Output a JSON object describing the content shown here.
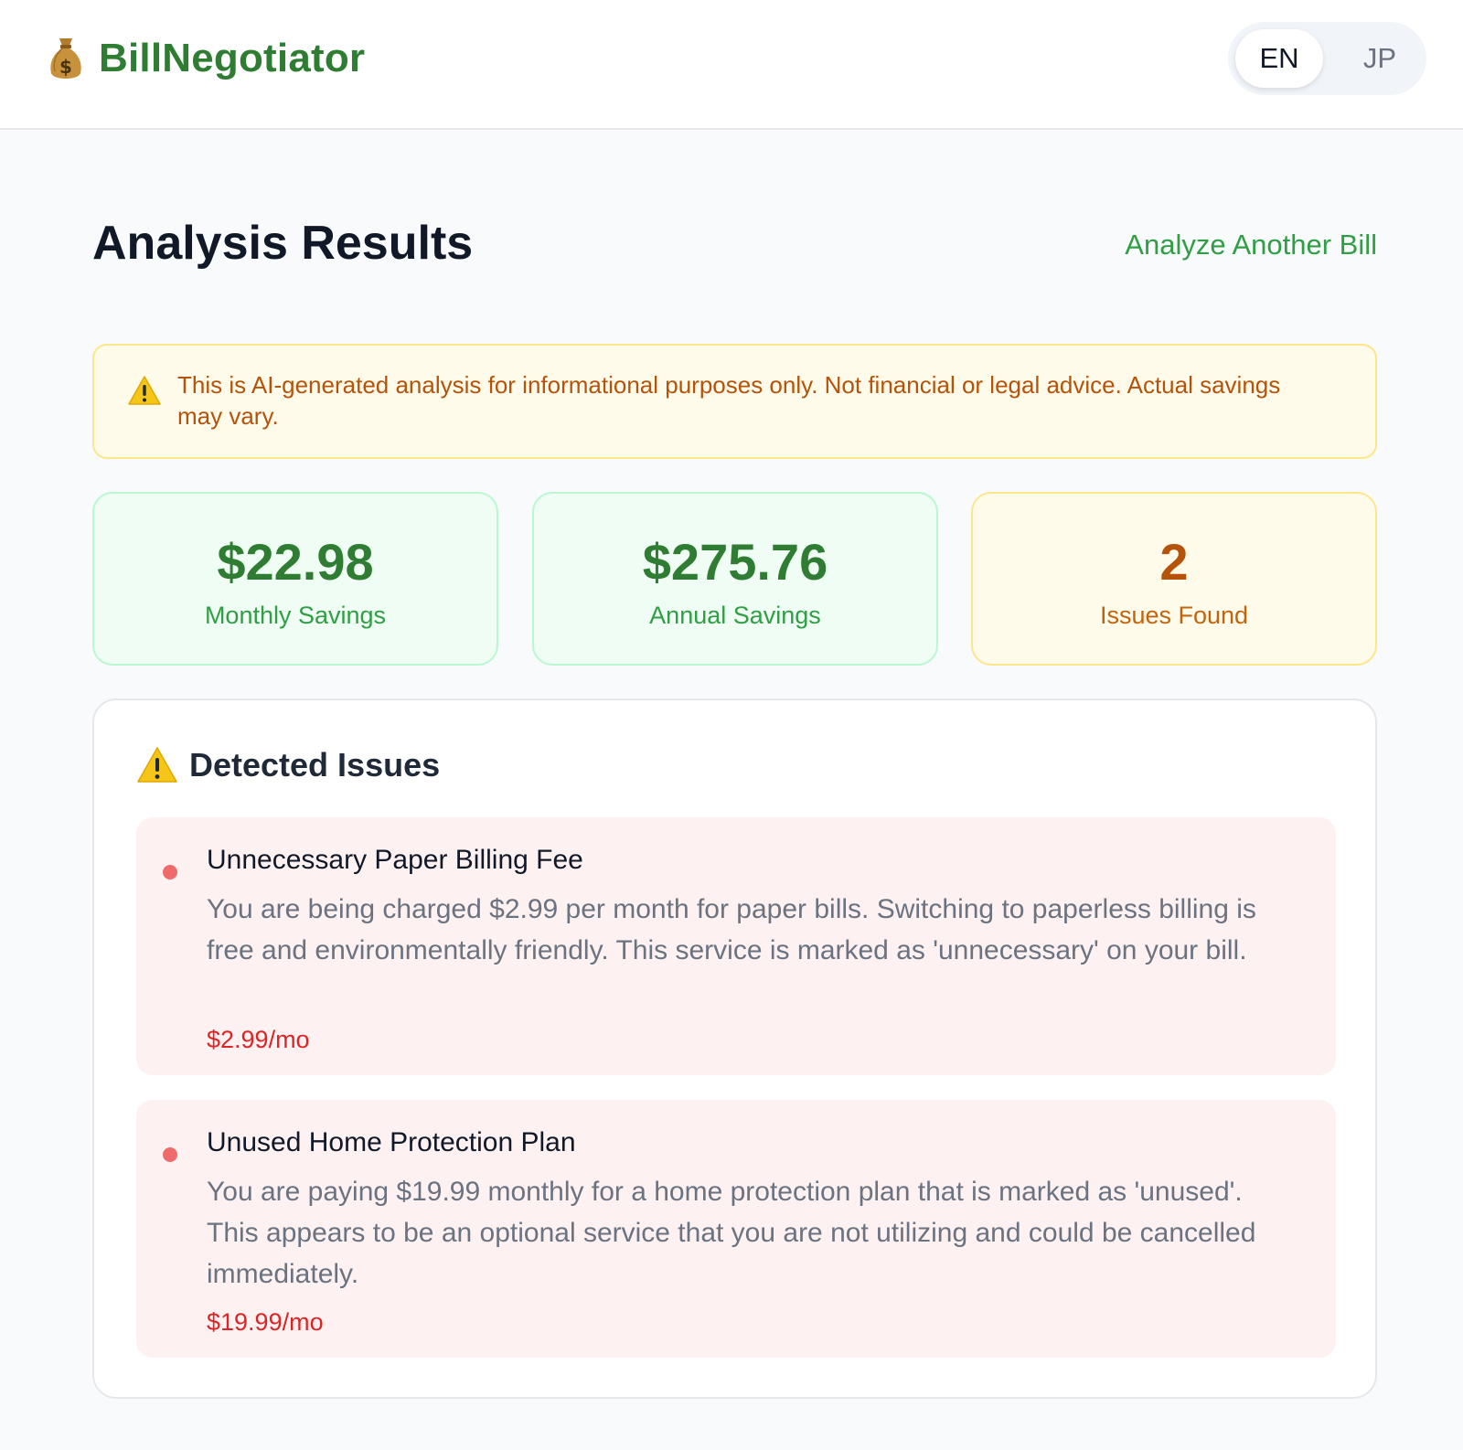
{
  "header": {
    "brand_icon": "money-bag-icon",
    "brand_name": "BillNegotiator",
    "languages": [
      {
        "label": "EN",
        "active": true
      },
      {
        "label": "JP",
        "active": false
      }
    ]
  },
  "page": {
    "title": "Analysis Results",
    "analyze_another_label": "Analyze Another Bill"
  },
  "disclaimer": {
    "icon": "warning-icon",
    "text": "This is AI-generated analysis for informational purposes only. Not financial or legal advice. Actual savings may vary."
  },
  "stats": [
    {
      "value": "$22.98",
      "label": "Monthly Savings"
    },
    {
      "value": "$275.76",
      "label": "Annual Savings"
    },
    {
      "value": "2",
      "label": "Issues Found"
    }
  ],
  "issues_section": {
    "icon": "warning-icon",
    "title": "Detected Issues",
    "items": [
      {
        "title": "Unnecessary Paper Billing Fee",
        "description": "You are being charged $2.99 per month for paper bills. Switching to paperless billing is free and environmentally friendly. This service is marked as 'unnecessary' on your bill.",
        "amount": "$2.99/mo"
      },
      {
        "title": "Unused Home Protection Plan",
        "description": "You are paying $19.99 monthly for a home protection plan that is marked as 'unused'. This appears to be an optional service that you are not utilizing and could be cancelled immediately.",
        "amount": "$19.99/mo"
      }
    ]
  },
  "colors": {
    "brand_green": "#2e7d32",
    "link_green": "#2f9e44",
    "warning_amber": "#b45309",
    "issue_red": "#dc2626",
    "issue_bg": "#fdf1f1"
  }
}
